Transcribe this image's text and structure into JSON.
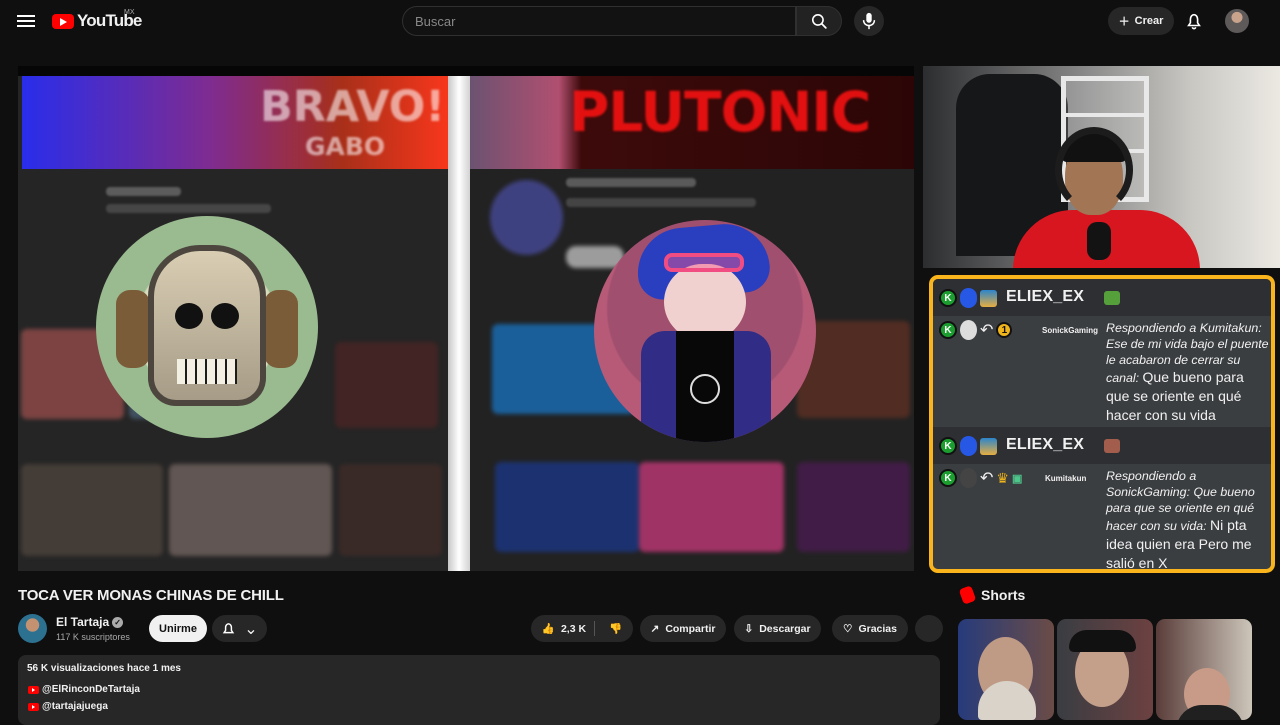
{
  "header": {
    "logo": "YouTube",
    "region": "MX",
    "search_placeholder": "Buscar",
    "create_label": "Crear"
  },
  "video": {
    "title": "TOCA VER MONAS CHINAS DE CHILL",
    "left_banner": "BRAVO!",
    "left_subtitle": "GABO",
    "right_banner": "PLUTONIC"
  },
  "chat": {
    "messages": [
      {
        "username": "ELIEX_EX",
        "reply_user": "SonickGaming",
        "reply_intro": "Respondiendo a Kumitakun: Ese de mi vida bajo el puente le acabaron de cerrar su canal:",
        "reply_text": "Que bueno para que se oriente en qué hacer con su vida"
      },
      {
        "username": "ELIEX_EX",
        "reply_user": "Kumitakun",
        "reply_intro": "Respondiendo a SonickGaming: Que bueno para que se oriente en qué hacer con su vida:",
        "reply_text": "Ni pta idea quien era Pero me salió en X"
      }
    ],
    "badge_number": "1"
  },
  "channel": {
    "name": "El Tartaja",
    "subscribers": "117 K suscriptores",
    "join_label": "Unirme"
  },
  "actions": {
    "likes": "2,3 K",
    "share": "Compartir",
    "download": "Descargar",
    "thanks": "Gracias"
  },
  "description": {
    "stats": "56 K visualizaciones  hace 1 mes",
    "links": [
      "@ElRinconDeTartaja",
      "@tartajajuega"
    ]
  },
  "sidebar": {
    "shorts_title": "Shorts"
  },
  "colors": {
    "accent": "#ff0000",
    "chat_border": "#f9b51b",
    "background": "#0f0f0f"
  }
}
